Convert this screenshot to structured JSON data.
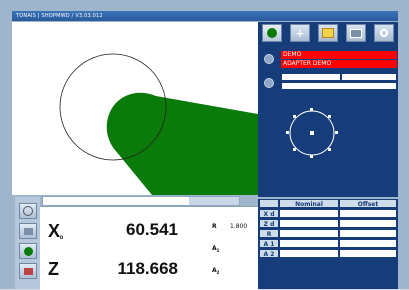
{
  "window": {
    "title": "TONAIS | SHOPMWD / V3.03.012"
  },
  "toolbar": {
    "icons": [
      "tool-icon",
      "plus-icon",
      "folder-icon",
      "layers-icon",
      "camera-icon"
    ]
  },
  "status": {
    "line1": "DEMO",
    "line2": "ADAPTER DEMO"
  },
  "readout": {
    "x_axis": "X",
    "x_sub": "D",
    "x_value": "60.541",
    "z_axis": "Z",
    "z_value": "118.668",
    "r_label": "R",
    "r_value": "1.800",
    "a1_label": "A",
    "a1_sub": "1",
    "a2_label": "A",
    "a2_sub": "2"
  },
  "offset_table": {
    "headers": [
      "",
      "Nominal",
      "Offset"
    ],
    "rows": [
      "X d",
      "Z d",
      "R",
      "A 1",
      "A 2"
    ]
  },
  "colors": {
    "panel": "#163d7a",
    "profile": "#0a7a0a",
    "alert": "#ff0000"
  }
}
